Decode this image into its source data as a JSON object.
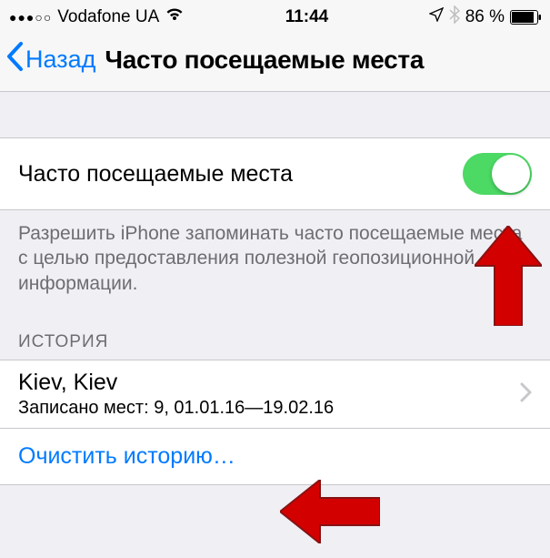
{
  "status": {
    "carrier": "Vodafone UA",
    "time": "11:44",
    "battery": "86 %"
  },
  "nav": {
    "back": "Назад",
    "title": "Часто посещаемые места"
  },
  "toggle_row": {
    "label": "Часто посещаемые места"
  },
  "description": "Разрешить iPhone запоминать часто посещаемые места с целью предоставления полезной геопозиционной информации.",
  "history": {
    "header": "ИСТОРИЯ",
    "items": [
      {
        "title": "Kiev, Kiev",
        "subtitle": "Записано мест: 9, 01.01.16—19.02.16"
      }
    ],
    "clear": "Очистить историю…"
  }
}
